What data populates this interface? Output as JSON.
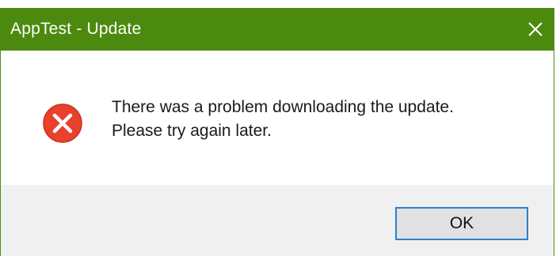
{
  "window": {
    "title": "AppTest - Update",
    "close_icon": "close-icon",
    "titlebar_color": "#4c8a0f"
  },
  "message": {
    "icon": "error-icon",
    "line1": "There was a problem downloading the update.",
    "line2": "Please try again later.",
    "icon_color": "#e8412c"
  },
  "buttons": {
    "ok_label": "OK",
    "focus_color": "#2a7fd4"
  }
}
